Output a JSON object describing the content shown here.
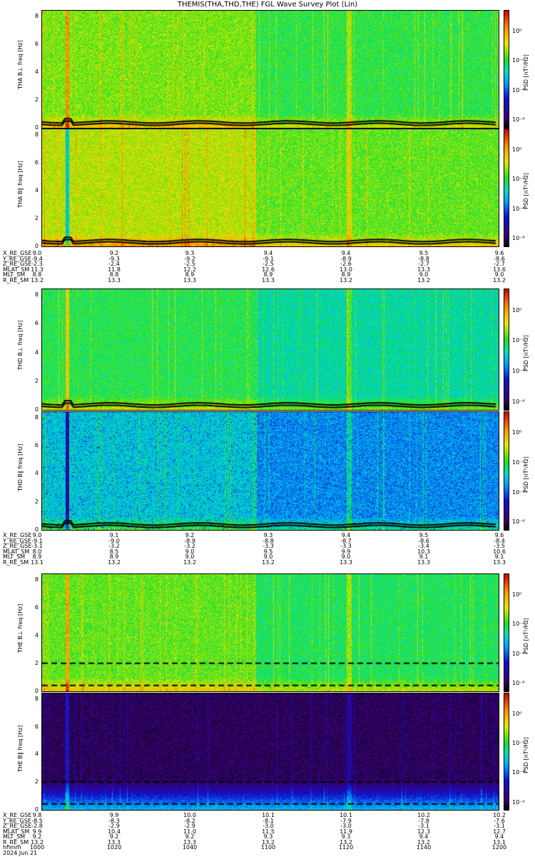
{
  "title": "THEMIS(THA,THD,THE) FGL Wave Survey Plot (Lin)",
  "colorbar": {
    "label": "PSD [nT²/Hz]",
    "ticks": [
      "10⁰",
      "10⁻²",
      "10⁻⁴",
      "10⁻⁶"
    ]
  },
  "yticks": [
    "0",
    "2",
    "4",
    "6",
    "8"
  ],
  "ephem_labels": [
    "X_RE_GSE",
    "Y_RE_GSE",
    "Z_RE_GSE",
    "MLAT_SM",
    "MLT_SM",
    "R_RE_SM"
  ],
  "ephem": [
    {
      "rows": [
        [
          "9.0",
          "9.2",
          "9.3",
          "9.4",
          "9.4",
          "9.5",
          "9.6"
        ],
        [
          "-9.4",
          "-9.3",
          "-9.2",
          "-9.1",
          "-8.9",
          "-8.8",
          "-8.6"
        ],
        [
          "-2.3",
          "-2.4",
          "-2.5",
          "-2.5",
          "-2.6",
          "-2.7",
          "-2.7"
        ],
        [
          "11.3",
          "11.8",
          "12.2",
          "12.6",
          "13.0",
          "13.3",
          "13.6"
        ],
        [
          "8.8",
          "8.8",
          "8.9",
          "8.9",
          "8.9",
          "9.0",
          "9.0"
        ],
        [
          "13.2",
          "13.3",
          "13.3",
          "13.3",
          "13.2",
          "13.2",
          "13.2"
        ]
      ]
    },
    {
      "rows": [
        [
          "9.0",
          "9.1",
          "9.2",
          "9.3",
          "9.4",
          "9.5",
          "9.6"
        ],
        [
          "-9.1",
          "-9.0",
          "-8.9",
          "-8.8",
          "-8.7",
          "-8.6",
          "-8.4"
        ],
        [
          "-3.1",
          "-3.2",
          "-3.2",
          "-3.3",
          "-3.3",
          "-3.4",
          "-3.5"
        ],
        [
          "8.0",
          "8.5",
          "9.0",
          "9.5",
          "9.9",
          "10.3",
          "10.6"
        ],
        [
          "8.9",
          "8.9",
          "9.0",
          "9.0",
          "9.0",
          "9.1",
          "9.1"
        ],
        [
          "13.1",
          "13.2",
          "13.2",
          "13.2",
          "13.3",
          "13.3",
          "13.3"
        ]
      ]
    },
    {
      "rows": [
        [
          "9.8",
          "9.9",
          "10.0",
          "10.1",
          "10.1",
          "10.2",
          "10.2"
        ],
        [
          "-8.5",
          "-8.3",
          "-8.2",
          "-8.1",
          "-7.9",
          "-7.8",
          "-7.6"
        ],
        [
          "-2.8",
          "-2.9",
          "-2.9",
          "-3.0",
          "-3.0",
          "-3.1",
          "-3.1"
        ],
        [
          "9.9",
          "10.4",
          "11.0",
          "11.5",
          "11.9",
          "12.3",
          "12.7"
        ],
        [
          "9.2",
          "9.2",
          "9.2",
          "9.3",
          "9.3",
          "9.4",
          "9.4"
        ],
        [
          "13.2",
          "13.3",
          "13.3",
          "13.2",
          "13.2",
          "13.2",
          "13.1"
        ]
      ],
      "hhmm_label": "hhmm",
      "hhmm": [
        "1000",
        "1020",
        "1040",
        "1100",
        "1120",
        "1140",
        "1200"
      ],
      "date": "2024 Jun 21"
    }
  ],
  "chart_data": {
    "type": "heatmap",
    "title": "THEMIS(THA,THD,THE) FGL Wave Survey Plot (Lin)",
    "xlabel": "hhmm",
    "x_ticks": [
      "1000",
      "1020",
      "1040",
      "1100",
      "1120",
      "1140",
      "1200"
    ],
    "ylim": [
      0,
      8
    ],
    "colorbar_range_log10": [
      -7,
      1
    ],
    "panels": [
      {
        "ylabel": "THA B⊥ freq [Hz]",
        "level": 0.6
      },
      {
        "ylabel": "THA B∥ freq [Hz]",
        "level": 0.65
      },
      {
        "ylabel": "THD B⊥ freq [Hz]",
        "level": 0.52
      },
      {
        "ylabel": "THD B∥ freq [Hz]",
        "level": 0.4
      },
      {
        "ylabel": "THE B⊥ freq [Hz]",
        "level": 0.58
      },
      {
        "ylabel": "THE B∥ freq [Hz]",
        "level": 0.08
      }
    ]
  }
}
